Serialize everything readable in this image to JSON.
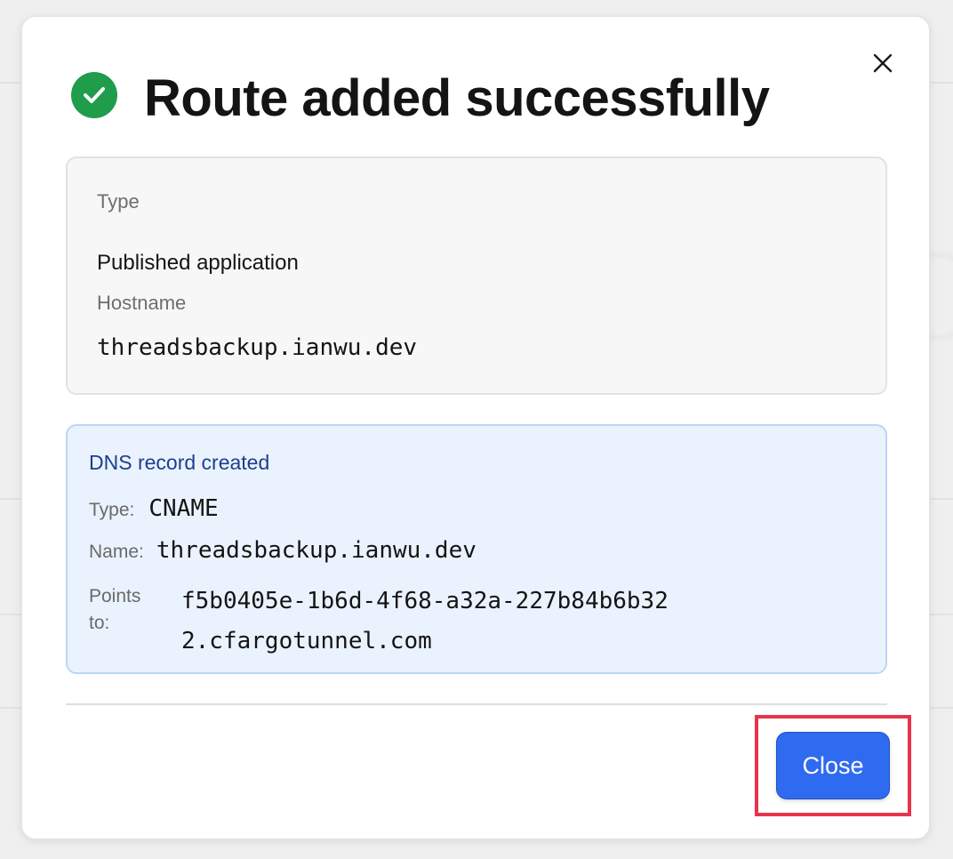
{
  "dialog": {
    "title": "Route added successfully",
    "icons": {
      "success": "check-circle-icon",
      "close": "close-icon"
    },
    "colors": {
      "success": "#1f9d4b",
      "primary_button": "#2f6bf0",
      "dns_card_bg": "#eaf2fd",
      "dns_title": "#1c3f8e",
      "highlight": "#e8334a"
    },
    "route": {
      "type_label": "Type",
      "type_value": "Published application",
      "hostname_label": "Hostname",
      "hostname_value": "threadsbackup.ianwu.dev"
    },
    "dns": {
      "title": "DNS record created",
      "type_label": "Type:",
      "type_value": "CNAME",
      "name_label": "Name:",
      "name_value": "threadsbackup.ianwu.dev",
      "points_label": "Points to:",
      "points_value": "f5b0405e-1b6d-4f68-a32a-227b84b6b322.cfargotunnel.com"
    },
    "close_button_label": "Close"
  }
}
